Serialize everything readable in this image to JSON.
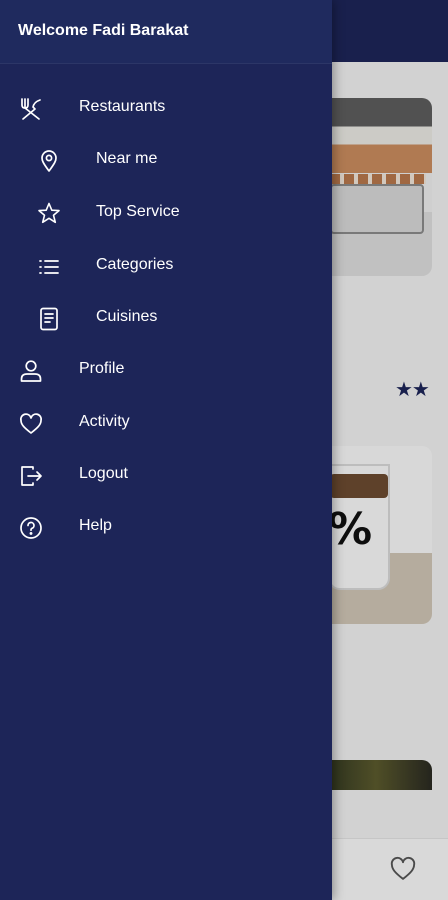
{
  "drawer": {
    "title": "Welcome Fadi Barakat",
    "items": [
      {
        "label": "Restaurants",
        "icon": "cutlery-icon"
      },
      {
        "label": "Near me",
        "icon": "location-pin-icon"
      },
      {
        "label": "Top Service",
        "icon": "star-icon"
      },
      {
        "label": "Categories",
        "icon": "list-icon"
      },
      {
        "label": "Cuisines",
        "icon": "document-icon"
      },
      {
        "label": "Profile",
        "icon": "user-icon"
      },
      {
        "label": "Activity",
        "icon": "heart-icon"
      },
      {
        "label": "Logout",
        "icon": "logout-icon"
      },
      {
        "label": "Help",
        "icon": "help-icon"
      }
    ]
  },
  "background": {
    "rating_stars": "★★",
    "card2_text": "%"
  },
  "colors": {
    "primary": "#1d2558",
    "drawer_header": "#1f2a5e",
    "text_on_primary": "#ffffff",
    "content_bg": "#f0f0f0"
  }
}
